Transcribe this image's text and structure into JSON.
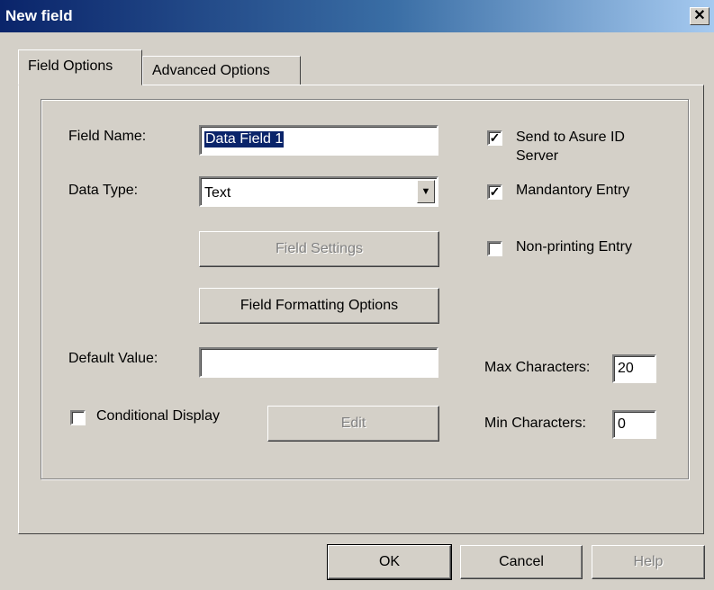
{
  "window": {
    "title": "New field",
    "close_glyph": "✕"
  },
  "tabs": [
    {
      "label": "Field Options",
      "active": true
    },
    {
      "label": "Advanced Options",
      "active": false
    }
  ],
  "form": {
    "field_name": {
      "label": "Field Name:",
      "value": "Data Field 1"
    },
    "data_type": {
      "label": "Data Type:",
      "value": "Text",
      "arrow_glyph": "▼"
    },
    "field_settings_button": {
      "label": "Field Settings",
      "enabled": false
    },
    "field_formatting_button": {
      "label": "Field Formatting Options",
      "enabled": true
    },
    "default_value": {
      "label": "Default Value:",
      "value": ""
    },
    "conditional_display": {
      "label": "Conditional Display",
      "checked": false
    },
    "edit_button": {
      "label": "Edit",
      "enabled": false
    }
  },
  "options": {
    "send_to_server": {
      "label_line1": "Send to Asure ID",
      "label_line2": "Server",
      "checked": true
    },
    "mandatory_entry": {
      "label": "Mandantory Entry",
      "checked": true
    },
    "non_printing_entry": {
      "label": "Non-printing Entry",
      "checked": false
    },
    "max_characters": {
      "label": "Max Characters:",
      "value": "20"
    },
    "min_characters": {
      "label": "Min Characters:",
      "value": "0"
    },
    "check_glyph": "✓"
  },
  "buttons": {
    "ok": {
      "label": "OK",
      "enabled": true
    },
    "cancel": {
      "label": "Cancel",
      "enabled": true
    },
    "help": {
      "label": "Help",
      "enabled": false
    }
  }
}
